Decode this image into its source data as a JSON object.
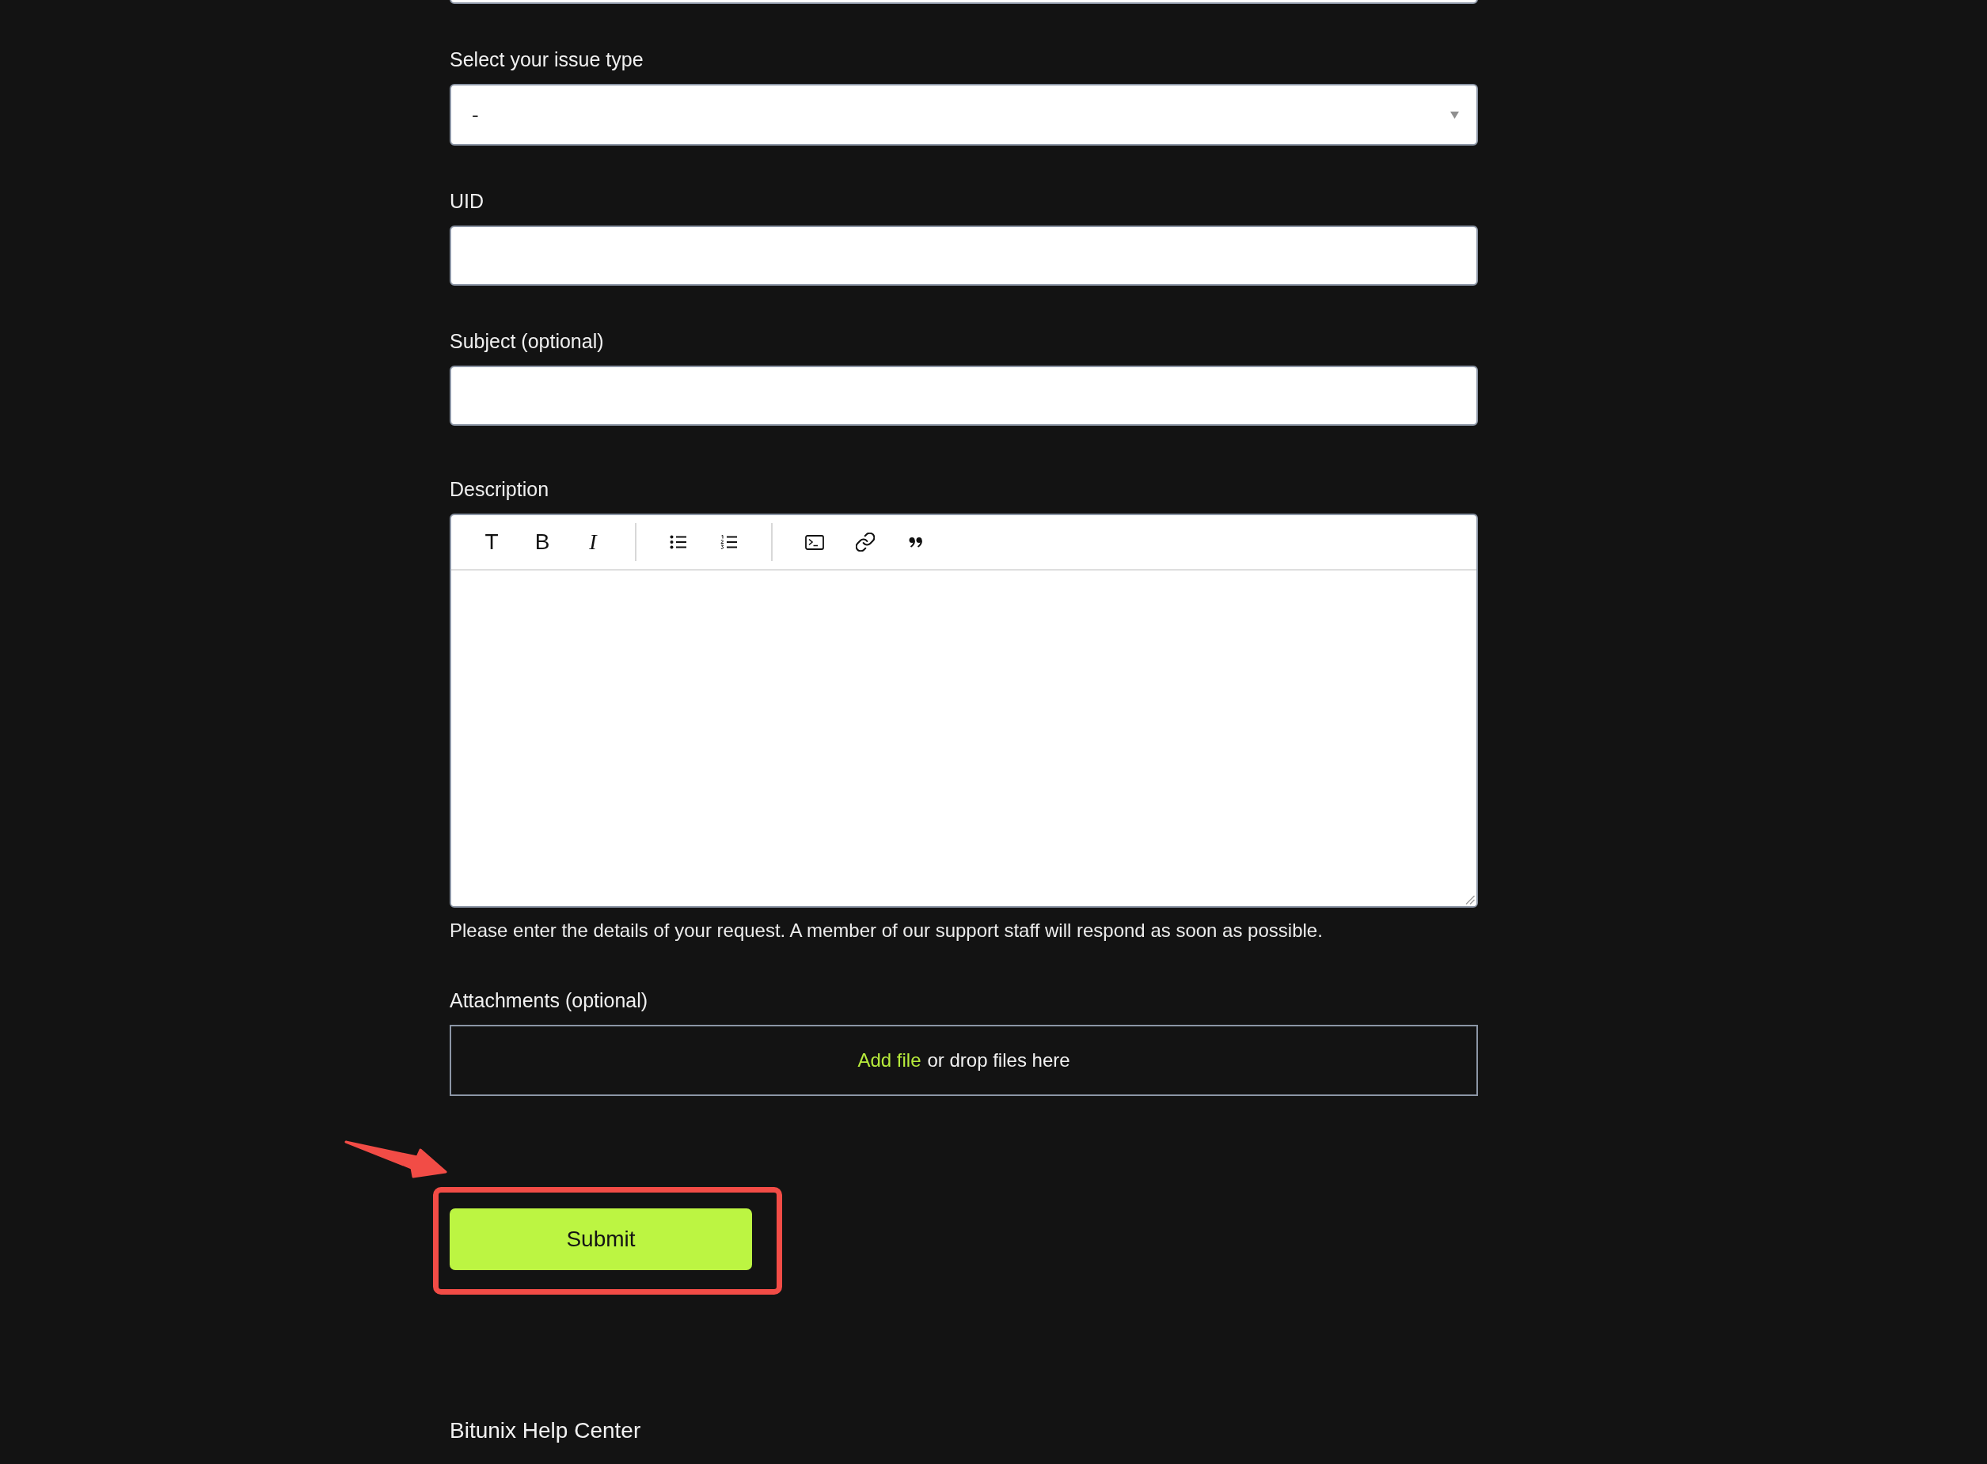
{
  "form": {
    "fields": [
      {
        "kind": "input"
      },
      {
        "kind": "select",
        "label": "Select your issue type",
        "value": "-"
      },
      {
        "kind": "input",
        "label": "UID"
      },
      {
        "kind": "input",
        "label": "Subject (optional)"
      },
      {
        "kind": "editor",
        "label": "Description",
        "format_buttons": [
          {
            "kind": "text",
            "label": "T"
          },
          {
            "kind": "bold",
            "label": "B"
          },
          {
            "kind": "italic",
            "label": "I"
          }
        ],
        "hint": "Please enter the details of your request. A member of our support staff will respond as soon as possible."
      },
      {
        "kind": "dropzone",
        "label": "Attachments (optional)",
        "link": "Add file",
        "text": "or drop files here"
      }
    ],
    "submit_button": "Submit"
  },
  "footer": {
    "title": "Bitunix Help Center"
  }
}
